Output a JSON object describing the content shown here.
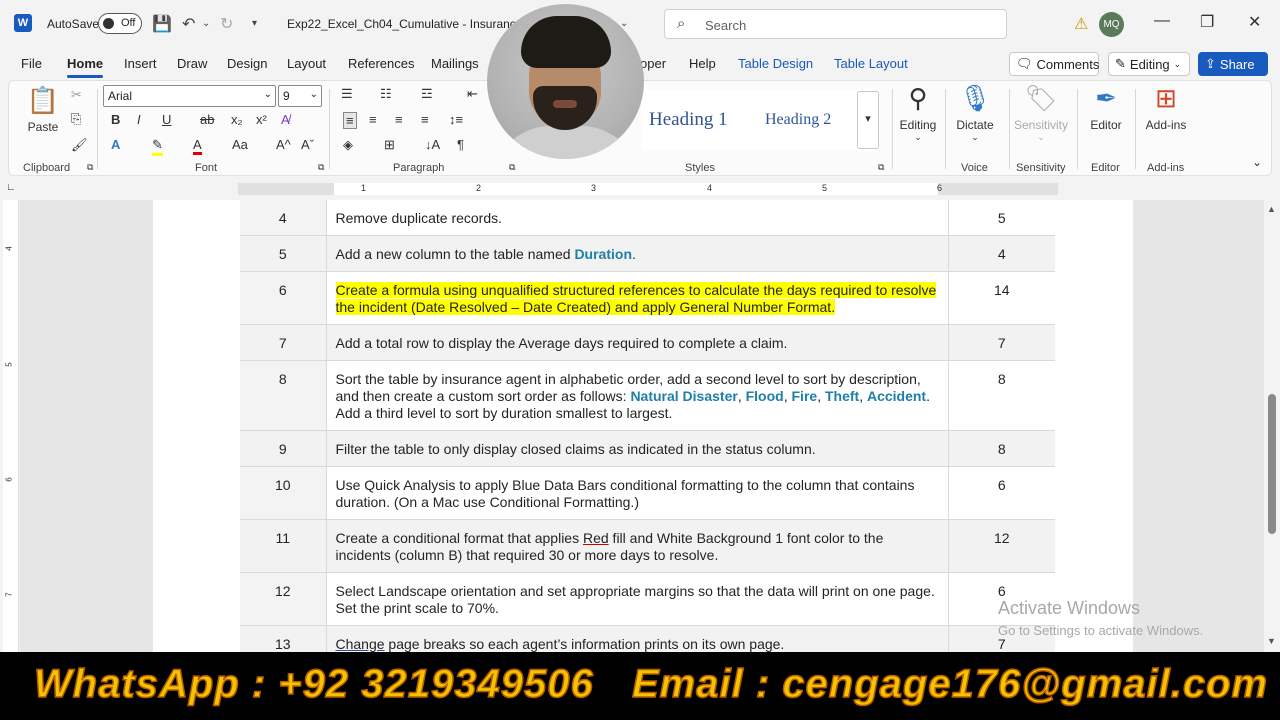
{
  "titlebar": {
    "autosave_label": "AutoSave",
    "autosave_state": "Off",
    "doc_title": "Exp22_Excel_Ch04_Cumulative - Insurance C",
    "search_placeholder": "Search",
    "user_initials": "MQ"
  },
  "tabs": [
    "File",
    "Home",
    "Insert",
    "Draw",
    "Design",
    "Layout",
    "References",
    "Mailings",
    "oper",
    "Help",
    "Table Design",
    "Table Layout"
  ],
  "active_tab": "Home",
  "right_buttons": {
    "comments": "Comments",
    "editing": "Editing",
    "share": "Share"
  },
  "ribbon": {
    "clipboard": {
      "paste": "Paste",
      "label": "Clipboard"
    },
    "font": {
      "name": "Arial",
      "size": "9",
      "label": "Font"
    },
    "paragraph": {
      "label": "Paragraph"
    },
    "styles": {
      "heading1": "Heading 1",
      "heading2": "Heading 2",
      "label": "Styles"
    },
    "editing": {
      "label": "Editing"
    },
    "voice": {
      "dictate": "Dictate",
      "label": "Voice"
    },
    "sensitivity": {
      "btn": "Sensitivity",
      "label": "Sensitivity"
    },
    "editor": {
      "btn": "Editor",
      "label": "Editor"
    },
    "addins": {
      "btn": "Add-ins",
      "label": "Add-ins"
    }
  },
  "ruler": {
    "h": [
      "1",
      "2",
      "3",
      "4",
      "5",
      "6"
    ],
    "v": [
      "4",
      "5",
      "6",
      "7"
    ]
  },
  "table_rows": [
    {
      "step": "4",
      "points": "5",
      "parts": [
        {
          "t": "Remove duplicate records."
        }
      ]
    },
    {
      "step": "5",
      "points": "4",
      "parts": [
        {
          "t": "Add a new column to the table named "
        },
        {
          "t": "Duration",
          "c": "kw"
        },
        {
          "t": "."
        }
      ]
    },
    {
      "step": "6",
      "points": "14",
      "parts": [
        {
          "t": "Create a formula using unqualified structured references to calculate the days required to resolve the incident (Date Resolved – Date Created) and apply General Number Format.",
          "c": "hl"
        }
      ]
    },
    {
      "step": "7",
      "points": "7",
      "parts": [
        {
          "t": "Add a total row to display the Average days required to complete a claim."
        }
      ]
    },
    {
      "step": "8",
      "points": "8",
      "parts": [
        {
          "t": "Sort the table by insurance agent in alphabetic order, add a second level to sort by description, and then create a custom sort order as follows: "
        },
        {
          "t": "Natural Disaster",
          "c": "kw"
        },
        {
          "t": ", "
        },
        {
          "t": "Flood",
          "c": "kw"
        },
        {
          "t": ", "
        },
        {
          "t": "Fire",
          "c": "kw"
        },
        {
          "t": ", "
        },
        {
          "t": "Theft",
          "c": "kw"
        },
        {
          "t": ", "
        },
        {
          "t": "Accident",
          "c": "kw"
        },
        {
          "t": ". Add a third level to sort by duration smallest to largest."
        }
      ]
    },
    {
      "step": "9",
      "points": "8",
      "parts": [
        {
          "t": "Filter the table to only display closed claims as indicated in the status column."
        }
      ]
    },
    {
      "step": "10",
      "points": "6",
      "parts": [
        {
          "t": "Use Quick Analysis to apply Blue Data Bars conditional formatting to the column that contains duration. (On a Mac use Conditional Formatting.)"
        }
      ]
    },
    {
      "step": "11",
      "points": "12",
      "parts": [
        {
          "t": "Create a conditional format that applies "
        },
        {
          "t": "Red",
          "c": "red-ul"
        },
        {
          "t": " fill and White Background 1 font color to the incidents (column B) that required 30 or more days to resolve."
        }
      ]
    },
    {
      "step": "12",
      "points": "6",
      "parts": [
        {
          "t": "Select Landscape orientation and set appropriate margins so that the data will print on one page. Set the print scale to 70%."
        }
      ]
    },
    {
      "step": "13",
      "points": "7",
      "parts": [
        {
          "t": "Change",
          "c": "blue-ul"
        },
        {
          "t": " page breaks so each agent’s information prints on its own page."
        }
      ]
    }
  ],
  "watermark": {
    "line1": "Activate Windows",
    "line2": "Go to Settings to activate Windows."
  },
  "banner": {
    "whatsapp": "WhatsApp  : +92 3219349506",
    "email": "Email  :  cengage176@gmail.com"
  }
}
